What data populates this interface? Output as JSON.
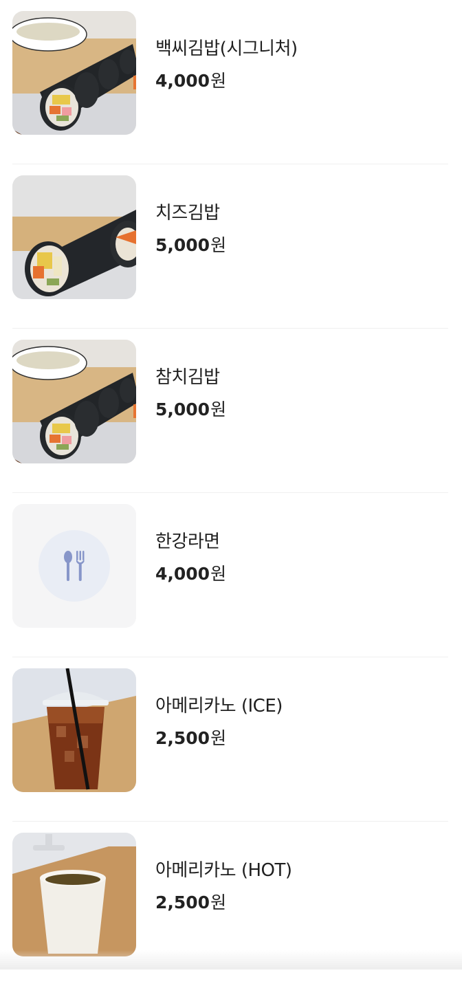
{
  "menu": {
    "items": [
      {
        "name": "백씨김밥(시그니처)",
        "price": "4,000",
        "unit": "원",
        "image": "kimbap-with-soup-photo"
      },
      {
        "name": "치즈김밥",
        "price": "5,000",
        "unit": "원",
        "image": "kimbap-roll-photo"
      },
      {
        "name": "참치김밥",
        "price": "5,000",
        "unit": "원",
        "image": "kimbap-with-soup-photo"
      },
      {
        "name": "한강라면",
        "price": "4,000",
        "unit": "원",
        "image": "spoon-fork-icon"
      },
      {
        "name": "아메리카노 (ICE)",
        "price": "2,500",
        "unit": "원",
        "image": "iced-coffee-photo"
      },
      {
        "name": "아메리카노 (HOT)",
        "price": "2,500",
        "unit": "원",
        "image": "hot-coffee-cup-photo"
      }
    ]
  },
  "colors": {
    "divider": "#efefef",
    "placeholder_bg": "#f5f5f6",
    "placeholder_circle": "#e9edf5",
    "utensil_icon": "#8796c9"
  }
}
